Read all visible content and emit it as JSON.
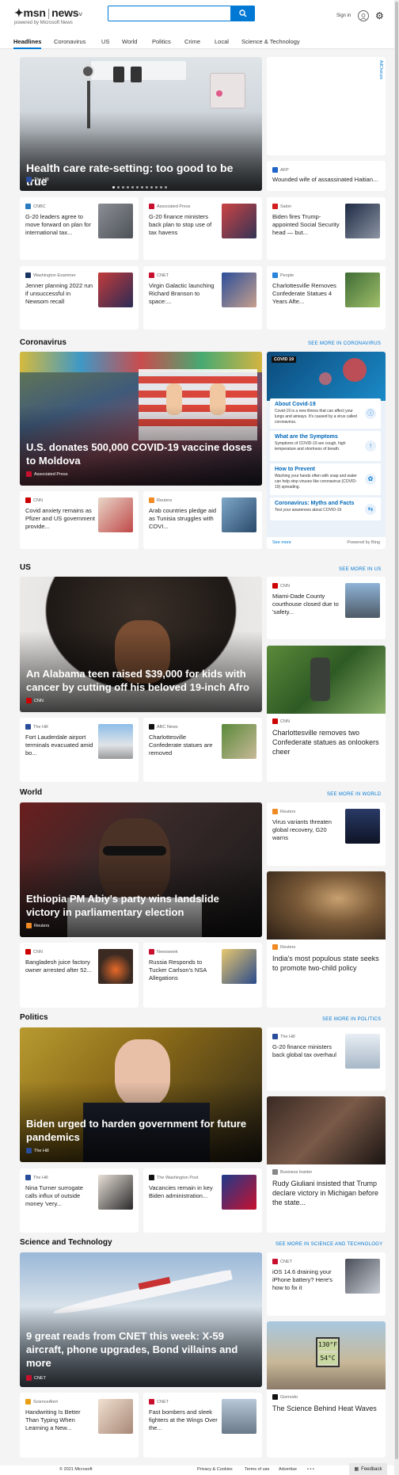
{
  "header": {
    "brand": "msn",
    "section": "news",
    "section_caret": "˅",
    "sub": "powered by Microsoft News",
    "search_placeholder": "",
    "signin": "Sign in"
  },
  "nav": [
    "Headlines",
    "Coronavirus",
    "US",
    "World",
    "Politics",
    "Crime",
    "Local",
    "Science & Technology"
  ],
  "top": {
    "hero": {
      "title": "Health care rate-setting: too good to be true",
      "source": "The Hill"
    },
    "ad_label": "AdChoices",
    "side": {
      "source": "AFP",
      "title": "Wounded wife of assassinated Haitian..."
    },
    "cards": [
      {
        "source": "CNBC",
        "title": "G-20 leaders agree to move forward on plan for international tax..."
      },
      {
        "source": "Associated Press",
        "title": "G-20 finance ministers back plan to stop use of tax havens"
      },
      {
        "source": "Salon",
        "title": "Biden fires Trump-appointed Social Security head — but..."
      },
      {
        "source": "Washington Examiner",
        "title": "Jenner planning 2022 run if unsuccessful in Newsom recall"
      },
      {
        "source": "CNET",
        "title": "Virgin Galactic launching Richard Branson to space:..."
      },
      {
        "source": "People",
        "title": "Charlottesville Removes Confederate Statues 4 Years Afte..."
      }
    ]
  },
  "coronavirus": {
    "heading": "Coronavirus",
    "see_more": "SEE MORE IN CORONAVIRUS",
    "hero": {
      "title": "U.S. donates 500,000 COVID-19 vaccine doses to Moldova",
      "source": "Associated Press"
    },
    "cards": [
      {
        "source": "CNN",
        "title": "Covid anxiety remains as Pfizer and US government provide..."
      },
      {
        "source": "Reuters",
        "title": "Arab countries pledge aid as Tunisia struggles with COVI..."
      }
    ],
    "panel": {
      "badge": "COVID 19",
      "items": [
        {
          "title": "About Covid-19",
          "desc": "Covid-19 is a new illness that can affect your lungs and airways. It's caused by a virus called coronavirus."
        },
        {
          "title": "What are the Symptoms",
          "desc": "Symptoms of COVID-19 are cough, high temperature and shortness of breath."
        },
        {
          "title": "How to Prevent",
          "desc": "Washing your hands often with soap and water can help stop viruses like coronavirus (COVID-19) spreading."
        },
        {
          "title": "Coronavirus: Myths and Facts",
          "desc": "Test your awareness about COVID-19"
        }
      ],
      "see_more": "See more",
      "powered": "Powered by Bing"
    }
  },
  "us": {
    "heading": "US",
    "see_more": "SEE MORE IN US",
    "hero": {
      "title": "An Alabama teen raised $39,000 for kids with cancer by cutting off his beloved 19-inch Afro",
      "source": "CNN"
    },
    "side": {
      "source": "CNN",
      "title": "Miami-Dade County courthouse closed due to 'safety..."
    },
    "side_big": {
      "source": "CNN",
      "title": "Charlottesville removes two Confederate statues as onlookers cheer"
    },
    "cards": [
      {
        "source": "The Hill",
        "title": "Fort Lauderdale airport terminals evacuated amid bo..."
      },
      {
        "source": "ABC News",
        "title": "Charlottesville Confederate statues are removed"
      }
    ]
  },
  "world": {
    "heading": "World",
    "see_more": "SEE MORE IN WORLD",
    "hero": {
      "title": "Ethiopia PM Abiy's party wins landslide victory in parliamentary election",
      "source": "Reuters"
    },
    "side": {
      "source": "Reuters",
      "title": "Virus variants threaten global recovery, G20 warns"
    },
    "side_big": {
      "source": "Reuters",
      "title": "India's most populous state seeks to promote two-child policy"
    },
    "cards": [
      {
        "source": "CNN",
        "title": "Bangladesh juice factory owner arrested after 52..."
      },
      {
        "source": "Newsweek",
        "title": "Russia Responds to Tucker Carlson's NSA Allegations"
      }
    ]
  },
  "politics": {
    "heading": "Politics",
    "see_more": "SEE MORE IN POLITICS",
    "hero": {
      "title": "Biden urged to harden government for future pandemics",
      "source": "The Hill"
    },
    "side": {
      "source": "The Hill",
      "title": "G-20 finance ministers back global tax overhaul"
    },
    "side_big": {
      "source": "Business Insider",
      "title": "Rudy Giuliani insisted that Trump declare victory in Michigan before the state..."
    },
    "cards": [
      {
        "source": "The Hill",
        "title": "Nina Turner surrogate calls influx of outside money 'very..."
      },
      {
        "source": "The Washington Post",
        "title": "Vacancies remain in key Biden administration..."
      }
    ]
  },
  "science": {
    "heading": "Science and Technology",
    "see_more": "SEE MORE IN SCIENCE AND TECHNOLOGY",
    "hero": {
      "title": "9 great reads from CNET this week: X-59 aircraft, phone upgrades, Bond villains and more",
      "source": "CNET"
    },
    "side": {
      "source": "CNET",
      "title": "iOS 14.6 draining your iPhone battery? Here's how to fix it"
    },
    "side_big": {
      "source": "Gizmodo",
      "title": "The Science Behind Heat Waves"
    },
    "thermo": {
      "top": "130°F",
      "bottom": "54°C"
    },
    "cards": [
      {
        "source": "ScienceAlert",
        "title": "Handwriting Is Better Than Typing When Learning a New..."
      },
      {
        "source": "CNET",
        "title": "Fast bombers and sleek fighters at the Wings Over the..."
      }
    ]
  },
  "footer": {
    "copyright": "© 2021 Microsoft",
    "privacy": "Privacy & Cookies",
    "terms": "Terms of use",
    "advertise": "Advertise",
    "more": "• • •",
    "feedback": "Feedback"
  },
  "colors": {
    "accent": "#0078d4",
    "page_bg": "#f4f4f4",
    "card_bg": "#ffffff"
  }
}
